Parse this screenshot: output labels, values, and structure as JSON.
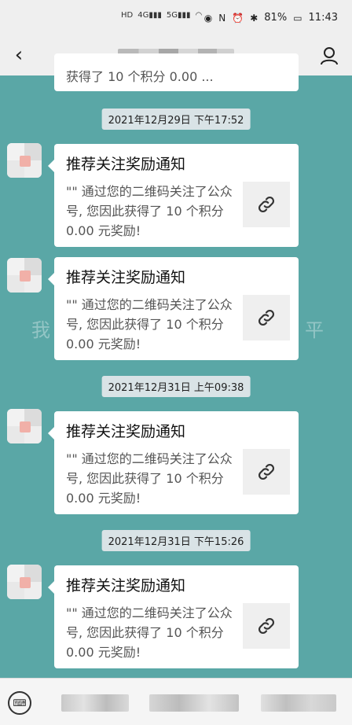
{
  "status_bar": {
    "battery": "81%",
    "time": "11:43"
  },
  "header": {
    "back_icon": "chevron-left-icon",
    "profile_icon": "person-icon"
  },
  "conversation": {
    "partial_previous": "获得了 10 个积分 0.00 ...",
    "items": [
      {
        "timestamp": "2021年12月29日 下午17:52",
        "messages": [
          {
            "title": "推荐关注奖励通知",
            "body": "\"\" 通过您的二维码关注了公众号, 您因此获得了 10 个积分 0.00 元奖励!",
            "thumb_icon": "link-icon"
          },
          {
            "title": "推荐关注奖励通知",
            "body": "\"\" 通过您的二维码关注了公众号, 您因此获得了 10 个积分 0.00 元奖励!",
            "thumb_icon": "link-icon"
          }
        ]
      },
      {
        "timestamp": "2021年12月31日 上午09:38",
        "messages": [
          {
            "title": "推荐关注奖励通知",
            "body": "\"\" 通过您的二维码关注了公众号, 您因此获得了 10 个积分 0.00 元奖励!",
            "thumb_icon": "link-icon"
          }
        ]
      },
      {
        "timestamp": "2021年12月31日 下午15:26",
        "messages": [
          {
            "title": "推荐关注奖励通知",
            "body": "\"\" 通过您的二维码关注了公众号, 您因此获得了 10 个积分 0.00 元奖励!",
            "thumb_icon": "link-icon"
          }
        ]
      }
    ]
  },
  "bottom_bar": {
    "keyboard_icon": "keyboard-icon"
  },
  "colors": {
    "chat_background": "#5aa7a6",
    "header_background": "#efefef",
    "timestamp_background": "#d9e3e6",
    "card_background": "#ffffff"
  }
}
